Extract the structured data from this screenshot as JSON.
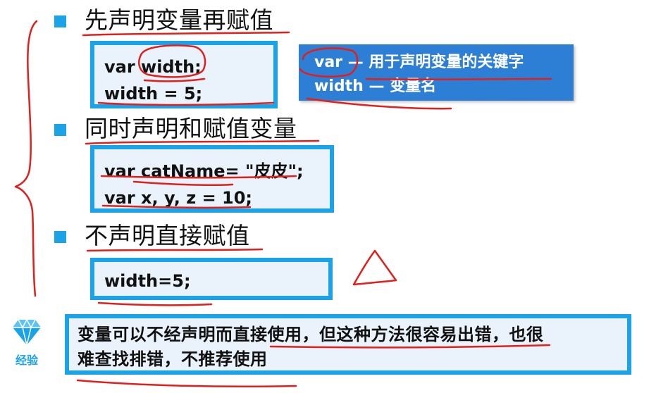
{
  "sections": [
    {
      "heading": "先声明变量再赋值",
      "code": [
        "var width;",
        "width = 5;"
      ]
    },
    {
      "heading": "同时声明和赋值变量",
      "code": [
        "var catName= \"皮皮\";",
        "var x, y, z = 10;"
      ]
    },
    {
      "heading": "不声明直接赋值",
      "code": [
        "width=5;"
      ]
    }
  ],
  "tip": {
    "line1": "var —  用于声明变量的关键字",
    "line2": "width — 变量名"
  },
  "experience": {
    "label": "经验",
    "icon": "diamond-icon",
    "note_line1": "变量可以不经声明而直接使用，但这种方法很容易出错，也很",
    "note_line2": "难查找排错，不推荐使用"
  },
  "colors": {
    "accent": "#1ba3e8",
    "tip_bg": "#2d7fd6",
    "ink": "#e0201c"
  }
}
